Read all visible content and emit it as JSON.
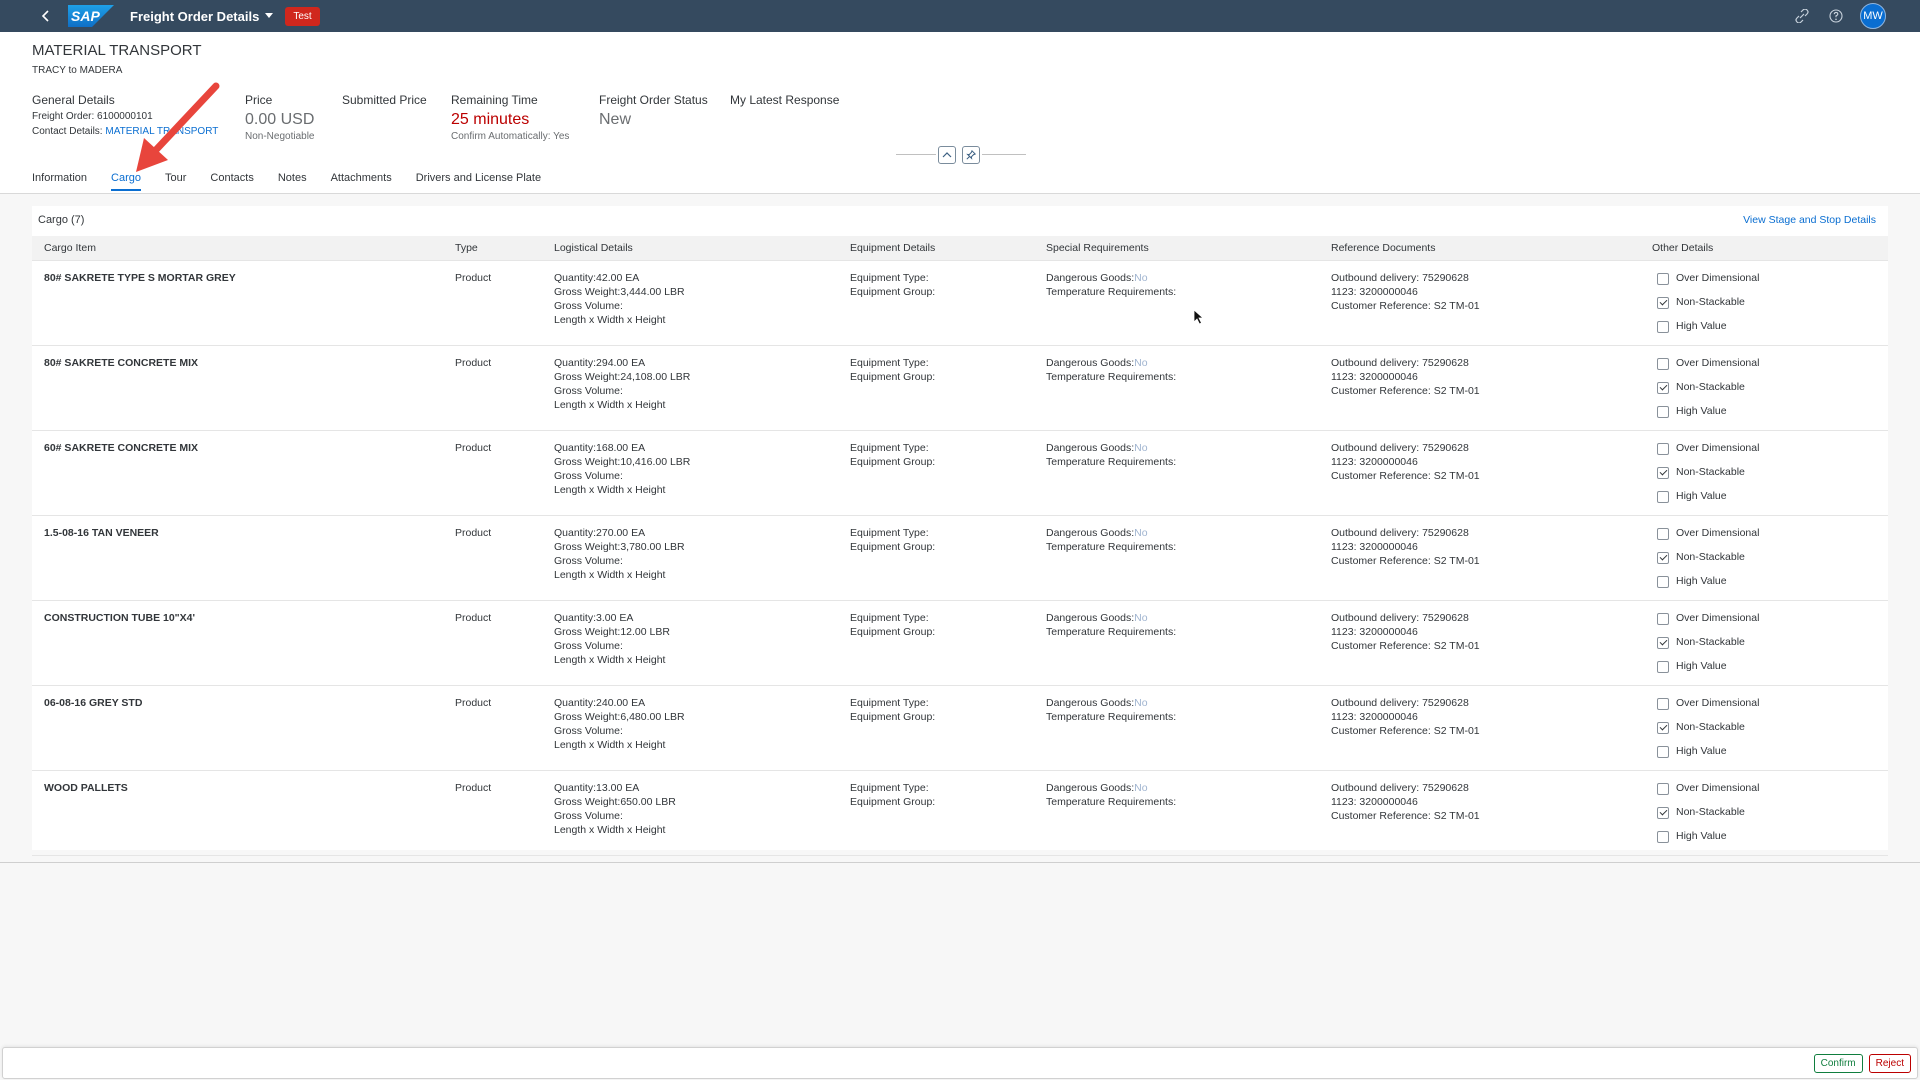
{
  "shell": {
    "logo_text": "SAP",
    "app_title": "Freight Order Details",
    "env_badge": "Test",
    "avatar_initials": "MW",
    "icons": [
      "back-icon",
      "chevron-down-icon",
      "share-icon",
      "help-icon"
    ]
  },
  "header": {
    "title": "MATERIAL TRANSPORT",
    "subtitle": "TRACY to MADERA",
    "general": {
      "label": "General Details",
      "freight_order_label": "Freight Order:",
      "freight_order_value": "6100000101",
      "contact_label": "Contact Details:",
      "contact_value": "MATERIAL TRANSPORT"
    },
    "price": {
      "label": "Price",
      "value": "0.00 USD",
      "note": "Non-Negotiable"
    },
    "submitted_price": {
      "label": "Submitted Price"
    },
    "remaining_time": {
      "label": "Remaining Time",
      "value": "25 minutes",
      "note": "Confirm Automatically: Yes"
    },
    "status": {
      "label": "Freight Order Status",
      "value": "New"
    },
    "latest_response": {
      "label": "My Latest Response"
    }
  },
  "tabs": [
    {
      "label": "Information",
      "active": false
    },
    {
      "label": "Cargo",
      "active": true
    },
    {
      "label": "Tour",
      "active": false
    },
    {
      "label": "Contacts",
      "active": false
    },
    {
      "label": "Notes",
      "active": false
    },
    {
      "label": "Attachments",
      "active": false
    },
    {
      "label": "Drivers and License Plate",
      "active": false
    }
  ],
  "cargo": {
    "title": "Cargo (7)",
    "view_link": "View Stage and Stop Details",
    "columns": [
      "Cargo Item",
      "Type",
      "Logistical Details",
      "Equipment Details",
      "Special Requirements",
      "Reference Documents",
      "Other Details"
    ],
    "field_labels": {
      "quantity": "Quantity:",
      "gross_weight": "Gross Weight:",
      "gross_volume": "Gross Volume:",
      "dimensions": "Length x Width x Height",
      "equipment_type": "Equipment Type:",
      "equipment_group": "Equipment Group:",
      "dangerous_goods": "Dangerous Goods:",
      "dangerous_goods_value": "No",
      "temperature": "Temperature Requirements:",
      "outbound": "Outbound delivery:",
      "ref_1123": "1123:",
      "customer_ref": "Customer Reference:"
    },
    "checkbox_labels": [
      "Over Dimensional",
      "Non-Stackable",
      "High Value"
    ],
    "rows": [
      {
        "item": "80# SAKRETE TYPE S MORTAR GREY",
        "type": "Product",
        "quantity": "42.00 EA",
        "gross_weight": "3,444.00 LBR",
        "outbound": "75290628",
        "ref_1123": "3200000046",
        "customer_ref": "S2 TM-01",
        "checks": [
          false,
          true,
          false
        ]
      },
      {
        "item": "80# SAKRETE CONCRETE MIX",
        "type": "Product",
        "quantity": "294.00 EA",
        "gross_weight": "24,108.00 LBR",
        "outbound": "75290628",
        "ref_1123": "3200000046",
        "customer_ref": "S2 TM-01",
        "checks": [
          false,
          true,
          false
        ]
      },
      {
        "item": "60# SAKRETE CONCRETE MIX",
        "type": "Product",
        "quantity": "168.00 EA",
        "gross_weight": "10,416.00 LBR",
        "outbound": "75290628",
        "ref_1123": "3200000046",
        "customer_ref": "S2 TM-01",
        "checks": [
          false,
          true,
          false
        ]
      },
      {
        "item": "1.5-08-16 TAN VENEER",
        "type": "Product",
        "quantity": "270.00 EA",
        "gross_weight": "3,780.00 LBR",
        "outbound": "75290628",
        "ref_1123": "3200000046",
        "customer_ref": "S2 TM-01",
        "checks": [
          false,
          true,
          false
        ]
      },
      {
        "item": "CONSTRUCTION TUBE 10\"X4'",
        "type": "Product",
        "quantity": "3.00 EA",
        "gross_weight": "12.00 LBR",
        "outbound": "75290628",
        "ref_1123": "3200000046",
        "customer_ref": "S2 TM-01",
        "checks": [
          false,
          true,
          false
        ]
      },
      {
        "item": "06-08-16 GREY STD",
        "type": "Product",
        "quantity": "240.00 EA",
        "gross_weight": "6,480.00 LBR",
        "outbound": "75290628",
        "ref_1123": "3200000046",
        "customer_ref": "S2 TM-01",
        "checks": [
          false,
          true,
          false
        ]
      },
      {
        "item": "WOOD PALLETS",
        "type": "Product",
        "quantity": "13.00 EA",
        "gross_weight": "650.00 LBR",
        "outbound": "75290628",
        "ref_1123": "3200000046",
        "customer_ref": "S2 TM-01",
        "checks": [
          false,
          true,
          false
        ]
      }
    ]
  },
  "footer": {
    "confirm_label": "Confirm",
    "reject_label": "Reject"
  },
  "colors": {
    "shell": "#354a5f",
    "accent": "#0a6ed1",
    "badge": "#d0271d",
    "remaining_time": "#bb0000",
    "confirm": "#107e3e",
    "reject": "#bb0000",
    "annotation_arrow": "#e8453c"
  }
}
